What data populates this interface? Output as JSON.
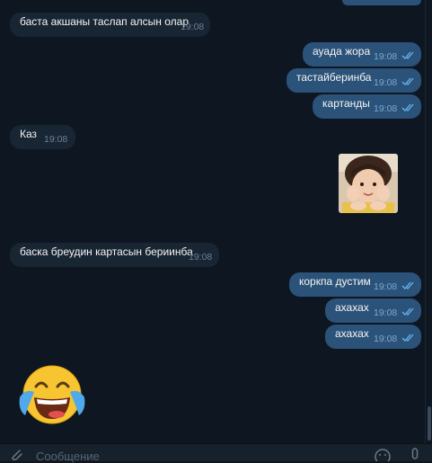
{
  "messages": [
    {
      "text": "баста акшаны таслап алсын олар",
      "time": "19:08"
    },
    {
      "text": "ауада жора",
      "time": "19:08"
    },
    {
      "text": "тастайберинба",
      "time": "19:08"
    },
    {
      "text": "картанды",
      "time": "19:08"
    },
    {
      "text": "Каз",
      "time": "19:08"
    },
    {
      "text": "баска бреудин картасын бериинба",
      "time": "19:08"
    },
    {
      "text": "коркпа дустим",
      "time": "19:08"
    },
    {
      "text": "ахахах",
      "time": "19:08"
    },
    {
      "text": "ахахах",
      "time": "19:08"
    }
  ],
  "sticker": {
    "description": "photo sticker of a smiling girl"
  },
  "emoji": {
    "name": "face-with-tears-of-joy-icon"
  },
  "composer": {
    "placeholder": "Сообщение"
  },
  "icons": {
    "attach": "paperclip-icon",
    "emoji": "smile-icon",
    "mic": "microphone-icon",
    "read": "double-check-icon"
  },
  "colors": {
    "background": "#0e1621",
    "incoming": "#182533",
    "outgoing": "#2b5278",
    "accent": "#64b5ef"
  }
}
